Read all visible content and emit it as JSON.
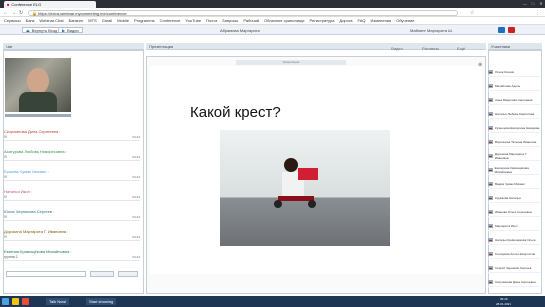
{
  "browser": {
    "tabs": [
      "Conference ELG"
    ],
    "url": "https://extra-webinar.mycomeeting.me/conference",
    "bookmarks": [
      "Сервисы",
      "Банк",
      "Webinar.Chat",
      "Банкинг",
      "MTS",
      "Gmail",
      "Mobile",
      "Programms",
      "Conference",
      "YouTube",
      "Почта",
      "Запросы",
      "Рабочий",
      "Облачное хранилище",
      "Регистратура",
      "Дорога",
      "FAQ",
      "Изменения",
      "Обучение"
    ]
  },
  "app": {
    "toolbar_buttons": [
      "Вернуть Вход",
      "Видео"
    ],
    "presenter_name": "Абрамова Маргарита",
    "stream_label": "Трансляция",
    "user_top": "Майнинг Маргарита Ш.",
    "panel_left_title": "Чат",
    "panel_center_title": "Презентация",
    "panel_right_title": "Участники",
    "right_controls": [
      "Видео",
      "Рисовать",
      "Ещё"
    ]
  },
  "chat": [
    {
      "name": "Скоромнова Дина Сергеевна :",
      "msg": "!!!",
      "time": "03:24"
    },
    {
      "name": "Ахатурова Любовь Новоресовна :",
      "msg": "!!!",
      "time": "03:24"
    },
    {
      "name": "Ершова Чумак Михаил :",
      "msg": "!!!",
      "time": "03:24"
    },
    {
      "name": "Наталья Икол :",
      "msg": "!!!",
      "time": "03:24"
    },
    {
      "name": "Юлия Черникова Сергеев :",
      "msg": "!!!",
      "time": "03:24"
    },
    {
      "name": "Дорокина Маргарита Г. Ивановна :",
      "msg": "!!!",
      "time": "03:24"
    },
    {
      "name": "Евгения Кривощёкова Михайловна :",
      "msg": "группа 2",
      "time": "03:24"
    }
  ],
  "slide": {
    "question": "Какой крест?"
  },
  "participants": [
    "Огнев Ксения",
    "Михайлова Адель",
    "Анна Марисова Сергеевна",
    "Наталья Любовь Кириллова",
    "Кузнецова Екатерина Назарова",
    "Воронцова Татьяна Иваночка",
    "Дорокина Маргарита Г. Ивановна",
    "Екатерина Кривощёкова Михайловна",
    "Вадим Чумак Михаил",
    "Кружкова Наталья",
    "Иванова Ольга Сергеевна",
    "Маргарита Икол",
    "Наталья Кривощёкова Ольга",
    "Гончарова Алла Новороссов",
    "Сергей Черников Сергеев",
    "Скоромнова Дина Сергеевна"
  ],
  "taskbar": {
    "start_label": "Talk Now!",
    "record": "Start showing",
    "clock": "06:49",
    "date": "28.01.2021"
  },
  "colors": {
    "accent": "#2b6cb0",
    "chat_names": [
      "#b5432b",
      "#2e8b57",
      "#5a9bd5",
      "#c54b8c",
      "#2f6e9a",
      "#7a5a00",
      "#1c7a40"
    ]
  }
}
